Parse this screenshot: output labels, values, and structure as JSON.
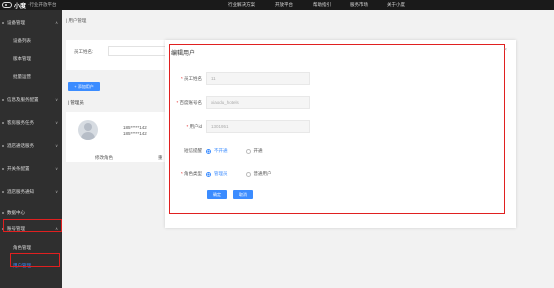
{
  "header": {
    "logo_name": "小度",
    "logo_tag": "·行业开放平台",
    "nav": [
      "行业解决方案",
      "开放平台",
      "帮助指引",
      "服务市场",
      "关于小度"
    ]
  },
  "sidebar": {
    "items": [
      {
        "label": "设备管理",
        "type": "group"
      },
      {
        "label": "设备列表",
        "type": "sub"
      },
      {
        "label": "版本管理",
        "type": "sub"
      },
      {
        "label": "批量运营",
        "type": "sub"
      },
      {
        "label": "信息及服务配置",
        "type": "group"
      },
      {
        "label": "客房服务任务",
        "type": "group"
      },
      {
        "label": "酒店通话服务",
        "type": "group"
      },
      {
        "label": "开关条配置",
        "type": "group"
      },
      {
        "label": "酒店服务通知",
        "type": "group"
      },
      {
        "label": "数据中心",
        "type": "group"
      },
      {
        "label": "账号管理",
        "type": "group"
      },
      {
        "label": "角色管理",
        "type": "sub"
      },
      {
        "label": "用户管理",
        "type": "sub"
      }
    ]
  },
  "main": {
    "breadcrumb": "| 用户管理",
    "filter_label": "员工姓名:",
    "add_button": "+ 添加用户",
    "section_title": "| 管理员",
    "card": {
      "phone1": "185*****142",
      "phone2": "185*****142",
      "footer_left": "修改角色",
      "footer_right": "重"
    }
  },
  "dialog": {
    "title": "编辑用户",
    "close_icon": "close-icon",
    "fields": [
      {
        "label": "员工姓名",
        "required": true,
        "value": "11"
      },
      {
        "label": "百度账号名",
        "required": true,
        "value": "xiaodu_hotels"
      },
      {
        "label": "用户id",
        "required": true,
        "value": "1301951"
      }
    ],
    "sms_label": "短信提醒",
    "sms_options": [
      "不开通",
      "开通"
    ],
    "sms_selected": 0,
    "role_label": "角色类型",
    "role_options": [
      "管理员",
      "普通用户"
    ],
    "role_selected": 0,
    "ok_label": "确定",
    "cancel_label": "取消"
  },
  "colors": {
    "accent": "#3b8cff",
    "highlight": "#e02020",
    "topbar": "#1a1a1a",
    "sidebar": "#2f2f2f"
  }
}
